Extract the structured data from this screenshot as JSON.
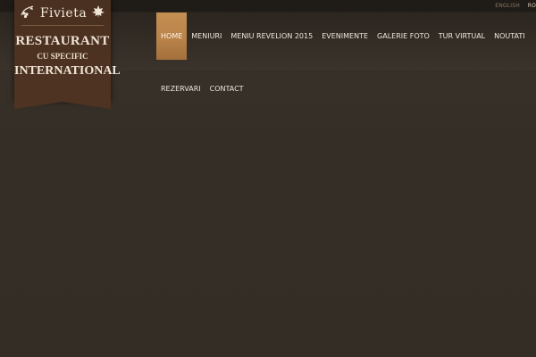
{
  "topbar": {
    "languages": [
      {
        "label": "ENGLISH",
        "active": false
      },
      {
        "label": "RO",
        "active": true
      }
    ]
  },
  "logo": {
    "brand": "Fivieta",
    "line1": "RESTAURANT",
    "line2": "CU SPECIFIC",
    "line3": "INTERNATIONAL",
    "icons": [
      "grapevine-icon",
      "maple-leaf-icon"
    ]
  },
  "nav": {
    "row1": [
      {
        "label": "HOME",
        "active": true
      },
      {
        "label": "MENIURI"
      },
      {
        "label": "MENIU REVELION 2015"
      },
      {
        "label": "EVENIMENTE"
      },
      {
        "label": "GALERIE FOTO"
      },
      {
        "label": "TUR VIRTUAL"
      },
      {
        "label": "NOUTATI"
      }
    ],
    "row2": [
      {
        "label": "REZERVARI"
      },
      {
        "label": "CONTACT"
      }
    ]
  },
  "colors": {
    "background": "#352e26",
    "accent": "#c48f52",
    "logo_bg": "#4a3020",
    "text": "#eee7db"
  }
}
